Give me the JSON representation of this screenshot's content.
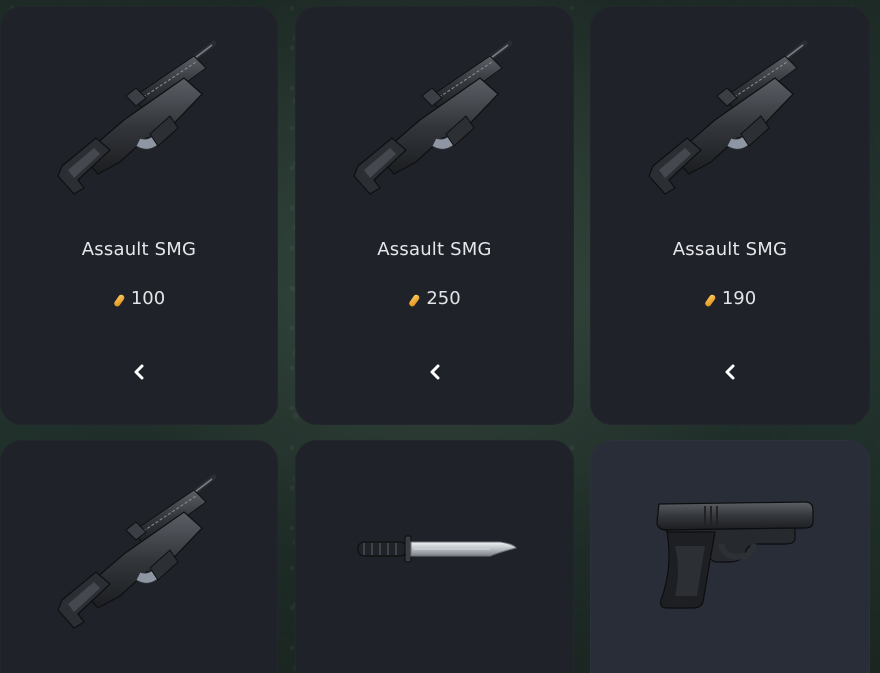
{
  "shop": {
    "items": [
      {
        "name": "Assault SMG",
        "price": "100",
        "icon": "smg-icon",
        "currency_icon": "ammo-icon",
        "action_icon": "chevron-left-icon"
      },
      {
        "name": "Assault SMG",
        "price": "250",
        "icon": "smg-icon",
        "currency_icon": "ammo-icon",
        "action_icon": "chevron-left-icon"
      },
      {
        "name": "Assault SMG",
        "price": "190",
        "icon": "smg-icon",
        "currency_icon": "ammo-icon",
        "action_icon": "chevron-left-icon"
      },
      {
        "icon": "smg-icon"
      },
      {
        "icon": "knife-icon"
      },
      {
        "icon": "pistol-icon"
      }
    ]
  },
  "colors": {
    "card": "#1f2228",
    "card_highlight": "#292d38",
    "text": "#e6e7ea",
    "currency": "#f0a81e",
    "background": "#243630"
  }
}
